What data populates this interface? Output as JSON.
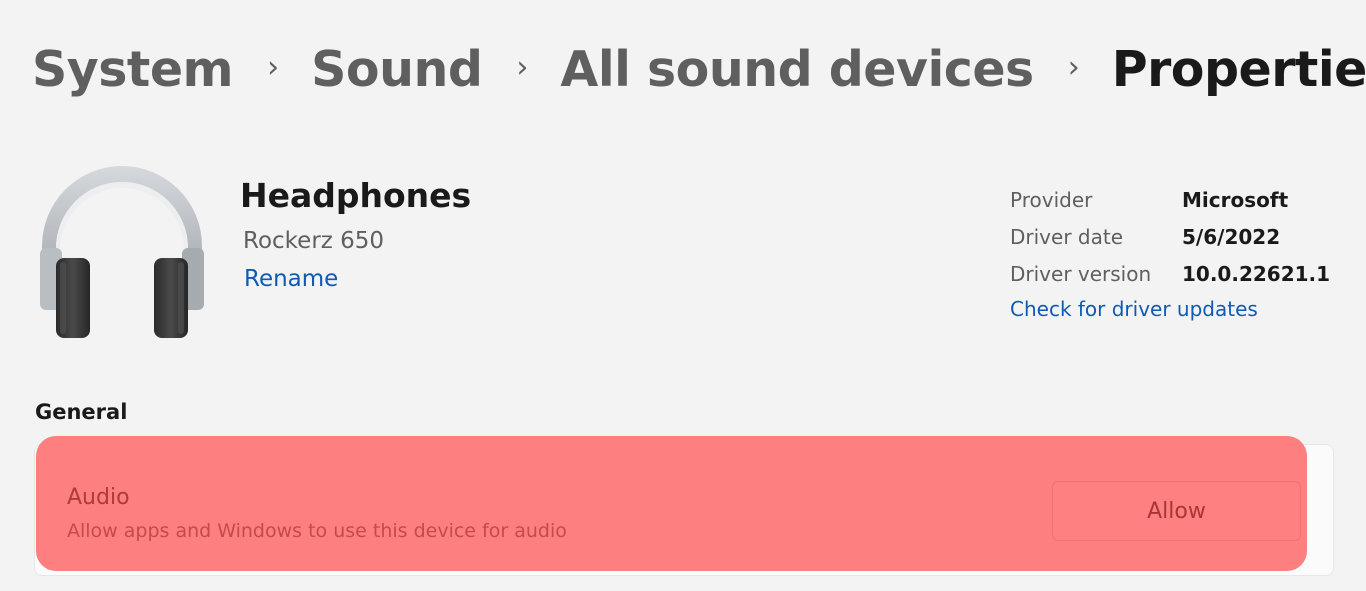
{
  "breadcrumb": {
    "items": [
      "System",
      "Sound",
      "All sound devices"
    ],
    "current": "Properties",
    "separator": "›"
  },
  "device": {
    "icon": "headphones-icon",
    "name": "Headphones",
    "model": "Rockerz 650",
    "rename_label": "Rename"
  },
  "driver": {
    "rows": [
      {
        "label": "Provider",
        "value": "Microsoft"
      },
      {
        "label": "Driver date",
        "value": "5/6/2022"
      },
      {
        "label": "Driver version",
        "value": "10.0.22621.1"
      }
    ],
    "update_link": "Check for driver updates"
  },
  "general": {
    "title": "General",
    "audio": {
      "title": "Audio",
      "description": "Allow apps and Windows to use this device for audio",
      "button_label": "Allow"
    }
  },
  "colors": {
    "accent_link": "#0f5ab4",
    "highlight": "#fe7f7f",
    "background": "#f3f3f3"
  }
}
